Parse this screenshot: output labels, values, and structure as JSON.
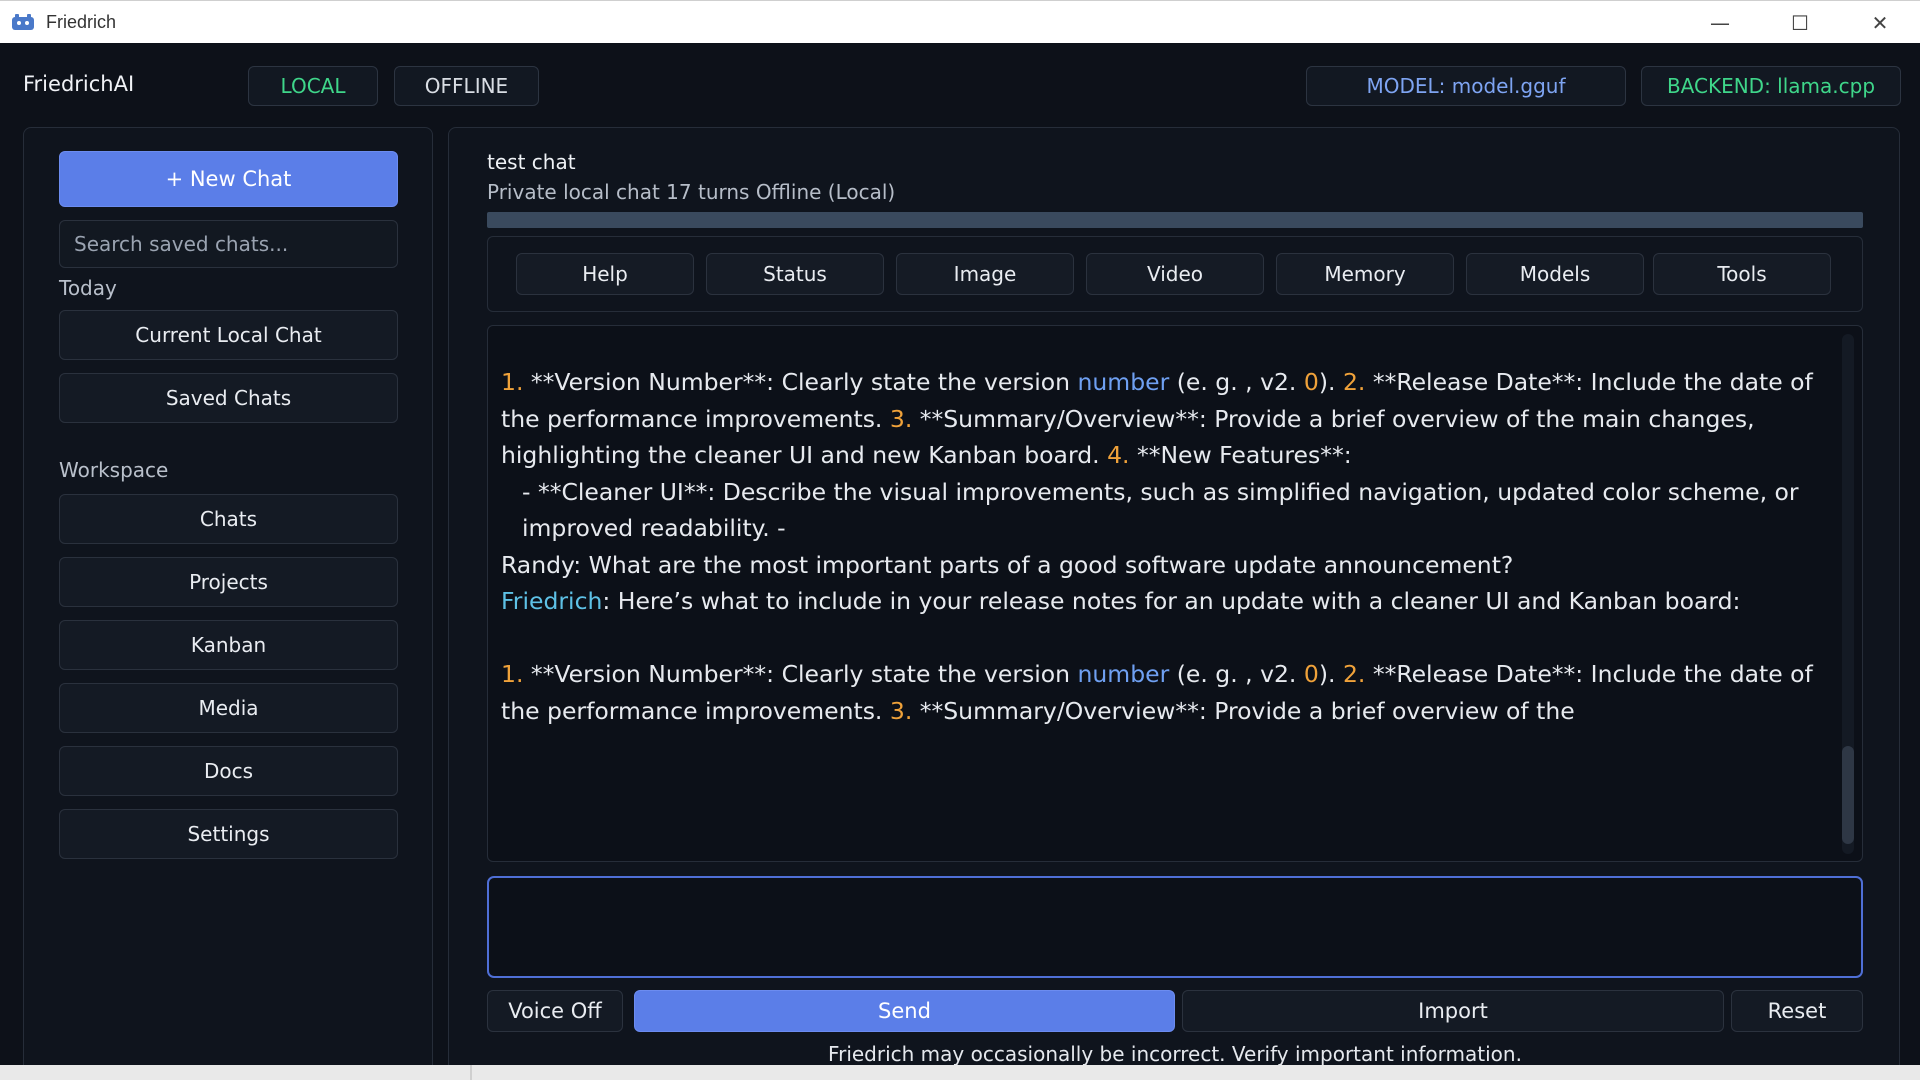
{
  "window": {
    "title": "Friedrich",
    "controls": {
      "minimize": "—",
      "maximize": "☐",
      "close": "✕"
    }
  },
  "header": {
    "brand": "FriedrichAI",
    "mode_local": "LOCAL",
    "mode_offline": "OFFLINE",
    "model": "MODEL: model.gguf",
    "backend": "BACKEND: llama.cpp"
  },
  "colors": {
    "accent": "#5b7ee8",
    "local_green": "#3fd68a",
    "model_blue": "#7ea4f2",
    "numbers_orange": "#f0a23a",
    "speaker_cyan": "#5ec1e6"
  },
  "sidebar": {
    "new_chat": "+  New Chat",
    "search_placeholder": "Search saved chats...",
    "today_label": "Today",
    "today_items": [
      "Current Local Chat",
      "Saved Chats"
    ],
    "workspace_label": "Workspace",
    "workspace_items": [
      "Chats",
      "Projects",
      "Kanban",
      "Media",
      "Docs",
      "Settings"
    ]
  },
  "chat": {
    "title": "test chat",
    "meta": "Private local chat  17 turns  Offline (Local)",
    "toolbar": [
      "Help",
      "Status",
      "Image",
      "Video",
      "Memory",
      "Models",
      "Tools"
    ],
    "messages": {
      "p1": {
        "n1": "1.",
        "t1": " **Version Number**: Clearly state the version ",
        "link": "number",
        "t2": " (e. g. , v2. ",
        "n0": "0",
        "t3": "). ",
        "n2": "2.",
        "t4": " **Release Date**: Include the date of the performance improvements. ",
        "n3": "3.",
        "t5": " **Summary/Overview**: Provide a brief overview of the main changes, highlighting the cleaner UI and new Kanban board. ",
        "n4": "4.",
        "t6": " **New Features**:"
      },
      "bullet": "- **Cleaner UI**: Describe the visual improvements, such as simplified navigation, updated color scheme, or improved readability. -",
      "randy": "Randy: What are the most important parts of a good software update announcement?",
      "friedrich_name": "Friedrich",
      "friedrich_text": ": Here’s what to include in your release notes for an update with a cleaner UI and Kanban board:",
      "p2": {
        "n1": "1.",
        "t1": " **Version Number**: Clearly state the version ",
        "link": "number",
        "t2": " (e. g. , v2. ",
        "n0": "0",
        "t3": "). ",
        "n2": "2.",
        "t4": " **Release Date**: Include the date of the performance improvements. ",
        "n3": "3.",
        "t5": " **Summary/Overview**: Provide a brief overview of the"
      }
    },
    "input_value": "",
    "buttons": {
      "voice": "Voice Off",
      "send": "Send",
      "import": "Import",
      "reset": "Reset"
    },
    "disclaimer": "Friedrich may occasionally be incorrect. Verify important information."
  }
}
